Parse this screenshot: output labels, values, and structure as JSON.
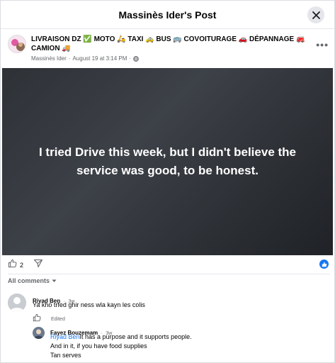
{
  "header": {
    "title": "Massinès Ider's Post"
  },
  "post": {
    "author_line": "LIVRAISON DZ ✅ MOTO 🛵 TAXI 🚕 BUS 🚌 COVOITURAGE 🚗 DÉPANNAGE 🚒 CAMION 🚚",
    "posted_by": "Massinès Ider",
    "date": "August 19 at 3:14 PM",
    "sep": "·",
    "text": "I tried Drive this week, but I didn't believe the service was good, to be honest.",
    "like_count": "2"
  },
  "comments_filter": {
    "label": "All comments"
  },
  "comments": [
    {
      "author": "Riyad Ben",
      "time": "3w",
      "text": "Ya kho trfed ghir ness wla kayn les colis",
      "edited": "Edited"
    },
    {
      "author": "Fayez Bouzemam",
      "time": "3w",
      "mention": "Riyad Ben",
      "text_line1": "It has a purpose and it supports people.",
      "text_line2": "And in it, if you have food supplies",
      "text_line3": "Tan serves"
    }
  ],
  "colors": {
    "accent": "#1877f2",
    "post_bg": "#2e3136"
  },
  "icons": [
    "close-icon",
    "globe-icon",
    "more-icon",
    "like-icon",
    "share-icon",
    "chevron-down-icon",
    "like-badge-icon"
  ]
}
